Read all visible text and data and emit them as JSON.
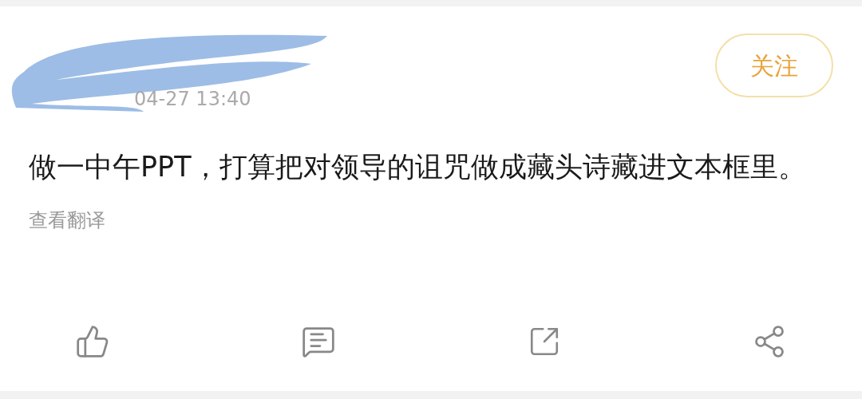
{
  "post": {
    "time": "04-27 13:40",
    "follow_button": "关注",
    "text": "做一中午PPT，打算把对领导的诅咒做成藏头诗藏进文本框里。",
    "translate_link": "查看翻译"
  }
}
